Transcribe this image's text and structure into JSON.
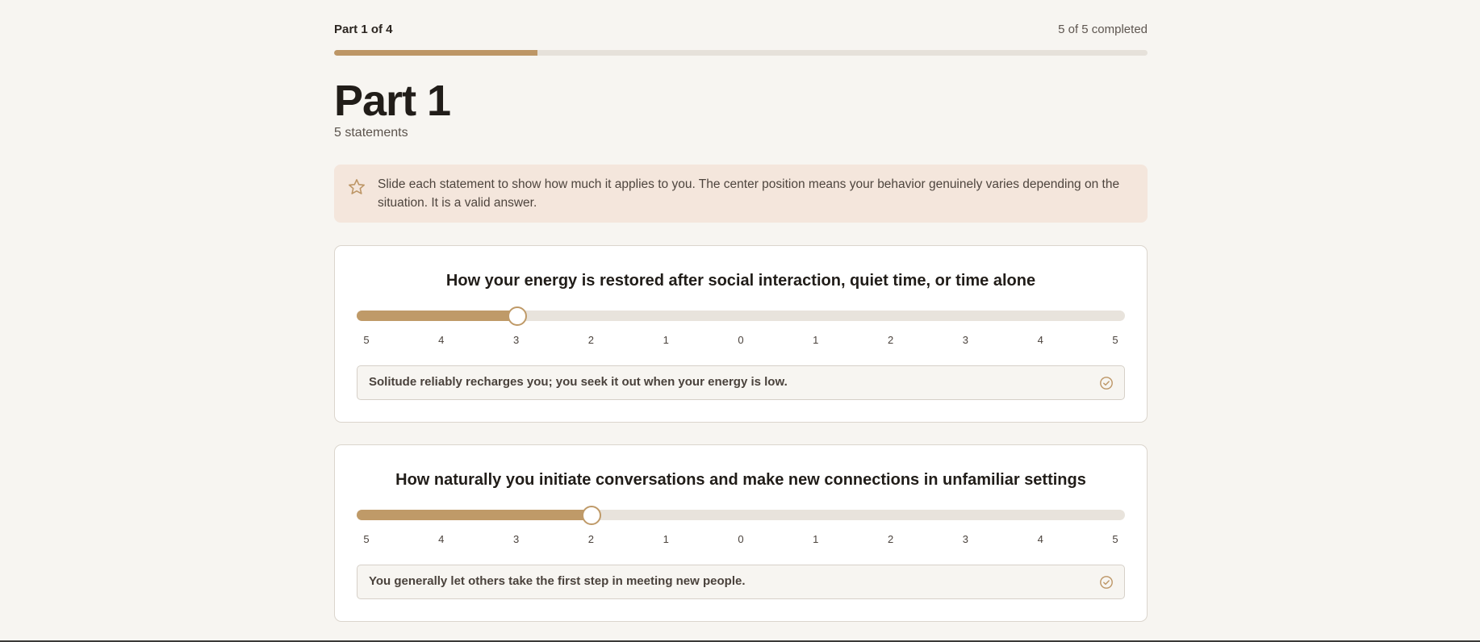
{
  "header": {
    "part_label": "Part 1 of 4",
    "completed_label": "5 of 5 completed",
    "progress_fraction": 0.25
  },
  "page": {
    "title": "Part 1",
    "subtitle": "5 statements"
  },
  "notice": {
    "icon": "star-icon",
    "text": "Slide each statement to show how much it applies to you. The center position means your behavior genuinely varies depending on the situation. It is a valid answer."
  },
  "scale_labels": [
    "5",
    "4",
    "3",
    "2",
    "1",
    "0",
    "1",
    "2",
    "3",
    "4",
    "5"
  ],
  "questions": [
    {
      "prompt": "How your energy is restored after social interaction, quiet time, or time alone",
      "slider_index": 2,
      "answer": "Solitude reliably recharges you; you seek it out when your energy is low.",
      "answer_icon": "check-circle-icon"
    },
    {
      "prompt": "How naturally you initiate conversations and make new connections in unfamiliar settings",
      "slider_index": 3,
      "answer": "You generally let others take the first step in meeting new people.",
      "answer_icon": "check-circle-icon"
    }
  ],
  "colors": {
    "accent": "#bd9666",
    "background": "#f7f5f1",
    "notice_bg": "#f4e6dc"
  }
}
